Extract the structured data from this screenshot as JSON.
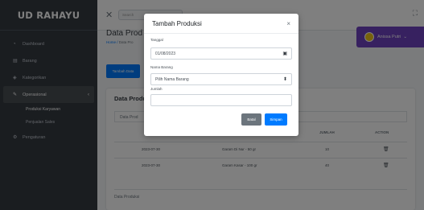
{
  "brand": "UD RAHAYU",
  "sidebar": {
    "items": [
      {
        "label": "Dashboard",
        "icon": "dashboard-icon"
      },
      {
        "label": "Barang",
        "icon": "box-icon"
      },
      {
        "label": "Kategorikan",
        "icon": "tag-icon"
      },
      {
        "label": "Operasional",
        "icon": "pencil-icon"
      },
      {
        "label": "Pengaturan",
        "icon": "gear-icon"
      }
    ],
    "sub_items": [
      {
        "label": "Produksi Karyawan"
      },
      {
        "label": "Penjualan Sales"
      }
    ]
  },
  "topbar": {
    "search_placeholder": "Search"
  },
  "page": {
    "title": "Data Prod",
    "breadcrumb_home": "Home",
    "breadcrumb_current": "Data Pro",
    "add_button": "Tambah Data"
  },
  "user": {
    "name": "Anissa Putri"
  },
  "card": {
    "title": "Data Produ",
    "subtitle": "Data Prod",
    "headers": {
      "jumlah": "JUMLAH",
      "action": "ACTION"
    },
    "rows": [
      {
        "tanggal": "2023-07-30",
        "barang": "Garam Di Nur - 50 gr",
        "jumlah": "10"
      },
      {
        "tanggal": "2023-07-30",
        "barang": "Garam Kasar - 100 gr",
        "jumlah": "40"
      }
    ],
    "footer": "Data Produksi"
  },
  "modal": {
    "title": "Tambah Produksi",
    "close": "×",
    "tanggal_label": "Tanggal",
    "tanggal_value": "01/08/2023",
    "barang_label": "Nama Barang",
    "barang_value": "Pilih Nama Barang",
    "jumlah_label": "Jumlah",
    "jumlah_value": "",
    "cancel_button": "Batal",
    "save_button": "Simpan"
  }
}
